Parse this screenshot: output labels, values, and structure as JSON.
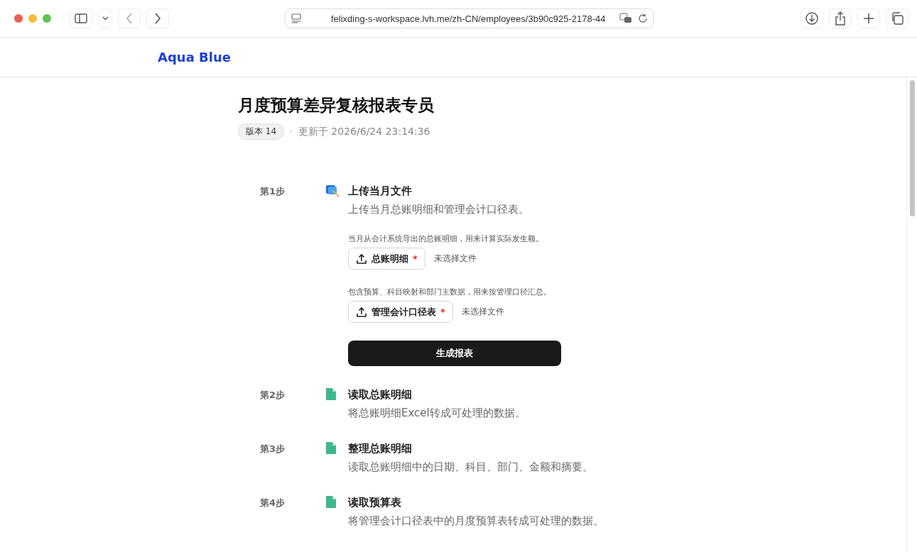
{
  "browser": {
    "url": "felixding-s-workspace.lvh.me/zh-CN/employees/3b90c925-2178-44"
  },
  "site": {
    "brand": "Aqua Blue"
  },
  "page": {
    "title": "月度预算差异复核报表专员",
    "version": "版本 14",
    "separator": "·",
    "updated": "更新于 2026/6/24 23:14:36"
  },
  "steps": [
    {
      "kind": "upload",
      "label": "第1步",
      "title": "上传当月文件",
      "description": "上传当月总账明细和管理会计口径表。",
      "uploads": [
        {
          "hint": "当月从会计系统导出的总账明细，用来计算实际发生额。",
          "button": "总账明细",
          "required_mark": "*",
          "status": "未选择文件"
        },
        {
          "hint": "包含预算、科目映射和部门主数据，用来按管理口径汇总。",
          "button": "管理会计口径表",
          "required_mark": "*",
          "status": "未选择文件"
        }
      ],
      "action": "生成报表"
    },
    {
      "kind": "csv",
      "label": "第2步",
      "title": "读取总账明细",
      "description": "将总账明细Excel转成可处理的数据。"
    },
    {
      "kind": "csv",
      "label": "第3步",
      "title": "整理总账明细",
      "description": "读取总账明细中的日期、科目、部门、金额和摘要。"
    },
    {
      "kind": "csv",
      "label": "第4步",
      "title": "读取预算表",
      "description": "将管理会计口径表中的月度预算表转成可处理的数据。"
    }
  ]
}
